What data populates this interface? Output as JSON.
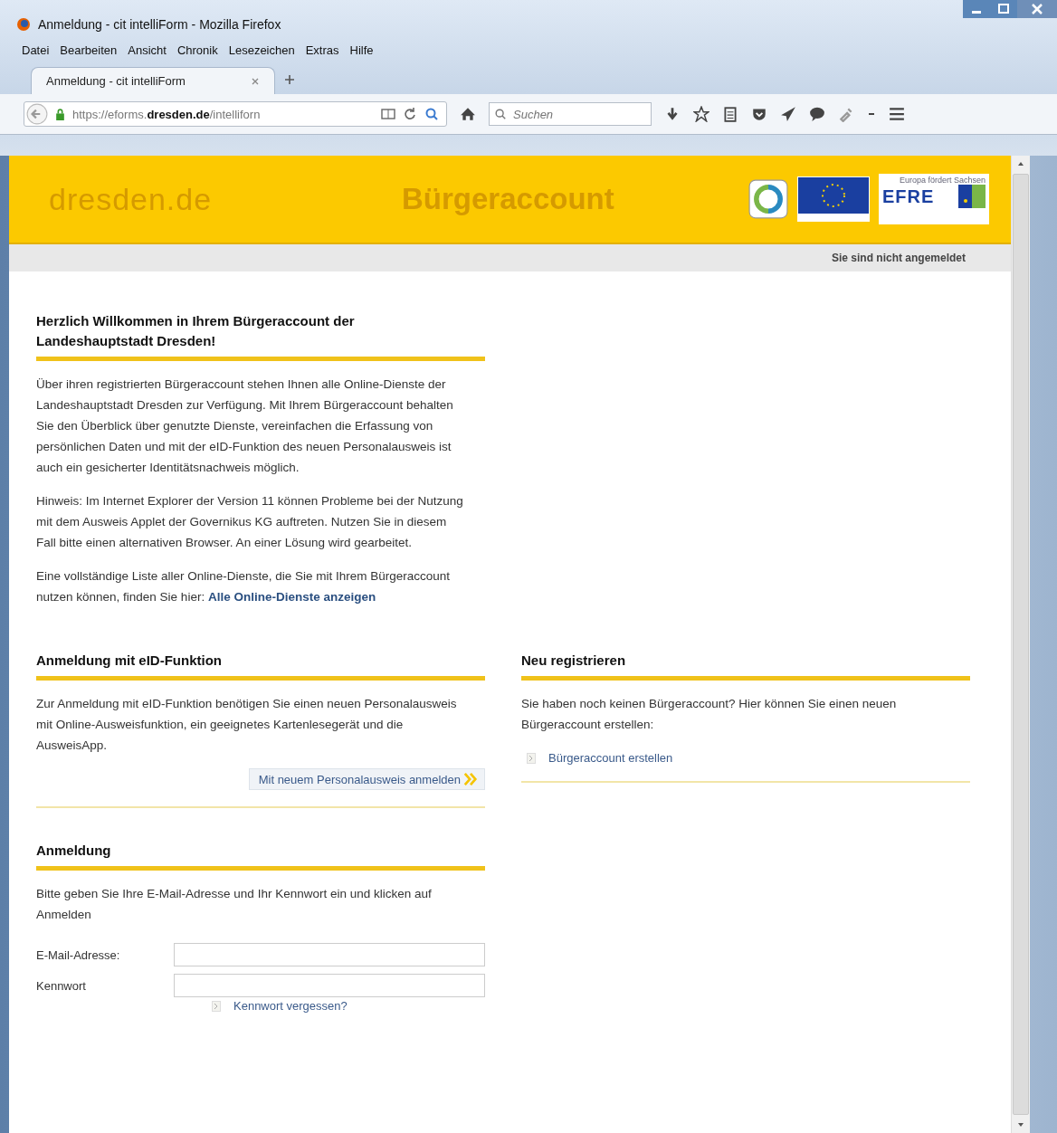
{
  "window": {
    "title": "Anmeldung - cit intelliForm - Mozilla Firefox"
  },
  "menu": [
    "Datei",
    "Bearbeiten",
    "Ansicht",
    "Chronik",
    "Lesezeichen",
    "Extras",
    "Hilfe"
  ],
  "tabs": [
    {
      "label": "Anmeldung - cit intelliForm",
      "selected": true
    }
  ],
  "address": {
    "url": "https://eforms.**dresden.de**/intelliforn"
  },
  "search": {
    "placeholder": "Suchen"
  },
  "header": {
    "site": "dresden.de",
    "title": "Bürgeraccount",
    "efre_claim": "Europa fördert Sachsen",
    "efre": "EFRE"
  },
  "status": "Sie sind nicht angemeldet",
  "welcome": {
    "heading": "Herzlich Willkommen in Ihrem Bürgeraccount der Landeshauptstadt Dresden!",
    "paragraphs": [
      "Über ihren registrierten Bürgeraccount stehen Ihnen alle Online-Dienste der Landeshauptstadt Dresden zur Verfügung. Mit Ihrem Bürgeraccount behalten Sie den Überblick über genutzte Dienste, vereinfachen die Erfassung von persönlichen Daten und mit der eID-Funktion des neuen Personalausweis ist auch ein gesicherter Identitätsnachweis möglich.",
      "Hinweis: Im Internet Explorer der Version 11 können Probleme bei der Nutzung mit dem Ausweis Applet der Governikus KG auftreten. Nutzen Sie in diesem Fall bitte einen alternativen Browser. An einer Lösung wird gearbeitet."
    ],
    "list_text": "Eine vollständige Liste aller Online-Dienste, die Sie mit Ihrem Bürgeraccount nutzen können, finden Sie hier:",
    "list_link": "Alle Online-Dienste anzeigen"
  },
  "eid": {
    "heading": "Anmeldung mit eID-Funktion",
    "text": "Zur Anmeldung mit eID-Funktion benötigen Sie einen neuen Personalausweis mit Online-Ausweisfunktion, ein geeignetes Kartenlesegerät und die AusweisApp.",
    "button": "Mit neuem Personalausweis anmelden"
  },
  "register": {
    "heading": "Neu registrieren",
    "text": "Sie haben noch keinen Bürgeraccount? Hier können Sie einen neuen Bürgeraccount erstellen:",
    "link": "Bürgeraccount erstellen"
  },
  "login": {
    "heading": "Anmeldung",
    "text": "Bitte geben Sie Ihre E-Mail-Adresse und Ihr Kennwort ein und klicken auf Anmelden",
    "fields": [
      {
        "label": "E-Mail-Adresse:"
      },
      {
        "label": "Kennwort"
      }
    ],
    "forgot": "Kennwort vergessen?"
  }
}
